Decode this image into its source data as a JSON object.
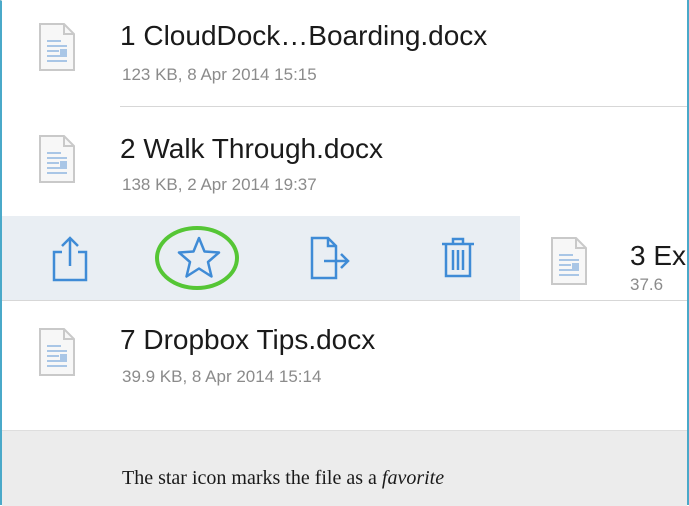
{
  "files": [
    {
      "title": "1 CloudDock…Boarding.docx",
      "meta": "123 KB, 8 Apr 2014 15:15"
    },
    {
      "title": "2 Walk Through.docx",
      "meta": "138 KB, 2 Apr 2014 19:37"
    },
    {
      "title": "3 Ex",
      "meta": "37.6"
    },
    {
      "title": "7 Dropbox Tips.docx",
      "meta": "39.9 KB, 8 Apr 2014 15:14"
    }
  ],
  "swipe_actions": [
    {
      "name": "share",
      "icon": "share-icon"
    },
    {
      "name": "favorite",
      "icon": "star-icon"
    },
    {
      "name": "move",
      "icon": "export-icon"
    },
    {
      "name": "delete",
      "icon": "trash-icon"
    }
  ],
  "caption": {
    "prefix": "The star icon marks the file as a ",
    "emphasis": "favorite"
  },
  "colors": {
    "accent_blue": "#3f8bd6",
    "highlight_green": "#55c635",
    "swipe_background": "#e9eef3"
  }
}
